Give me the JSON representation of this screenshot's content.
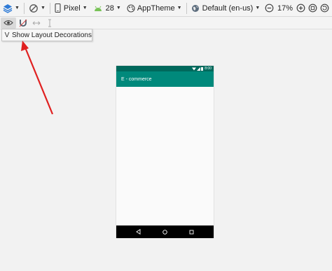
{
  "toolbar": {
    "device_label": "Pixel",
    "api_label": "28",
    "theme_label": "AppTheme",
    "locale_label": "Default (en-us)",
    "zoom_label": "17%"
  },
  "popup": {
    "check_mark": "V",
    "label": "Show Layout Decorations"
  },
  "device": {
    "status_time": "8:00",
    "app_title": "E - commerce"
  },
  "colors": {
    "status_bar": "#00695c",
    "app_bar": "#00897b",
    "annotation_arrow": "#e02020"
  }
}
